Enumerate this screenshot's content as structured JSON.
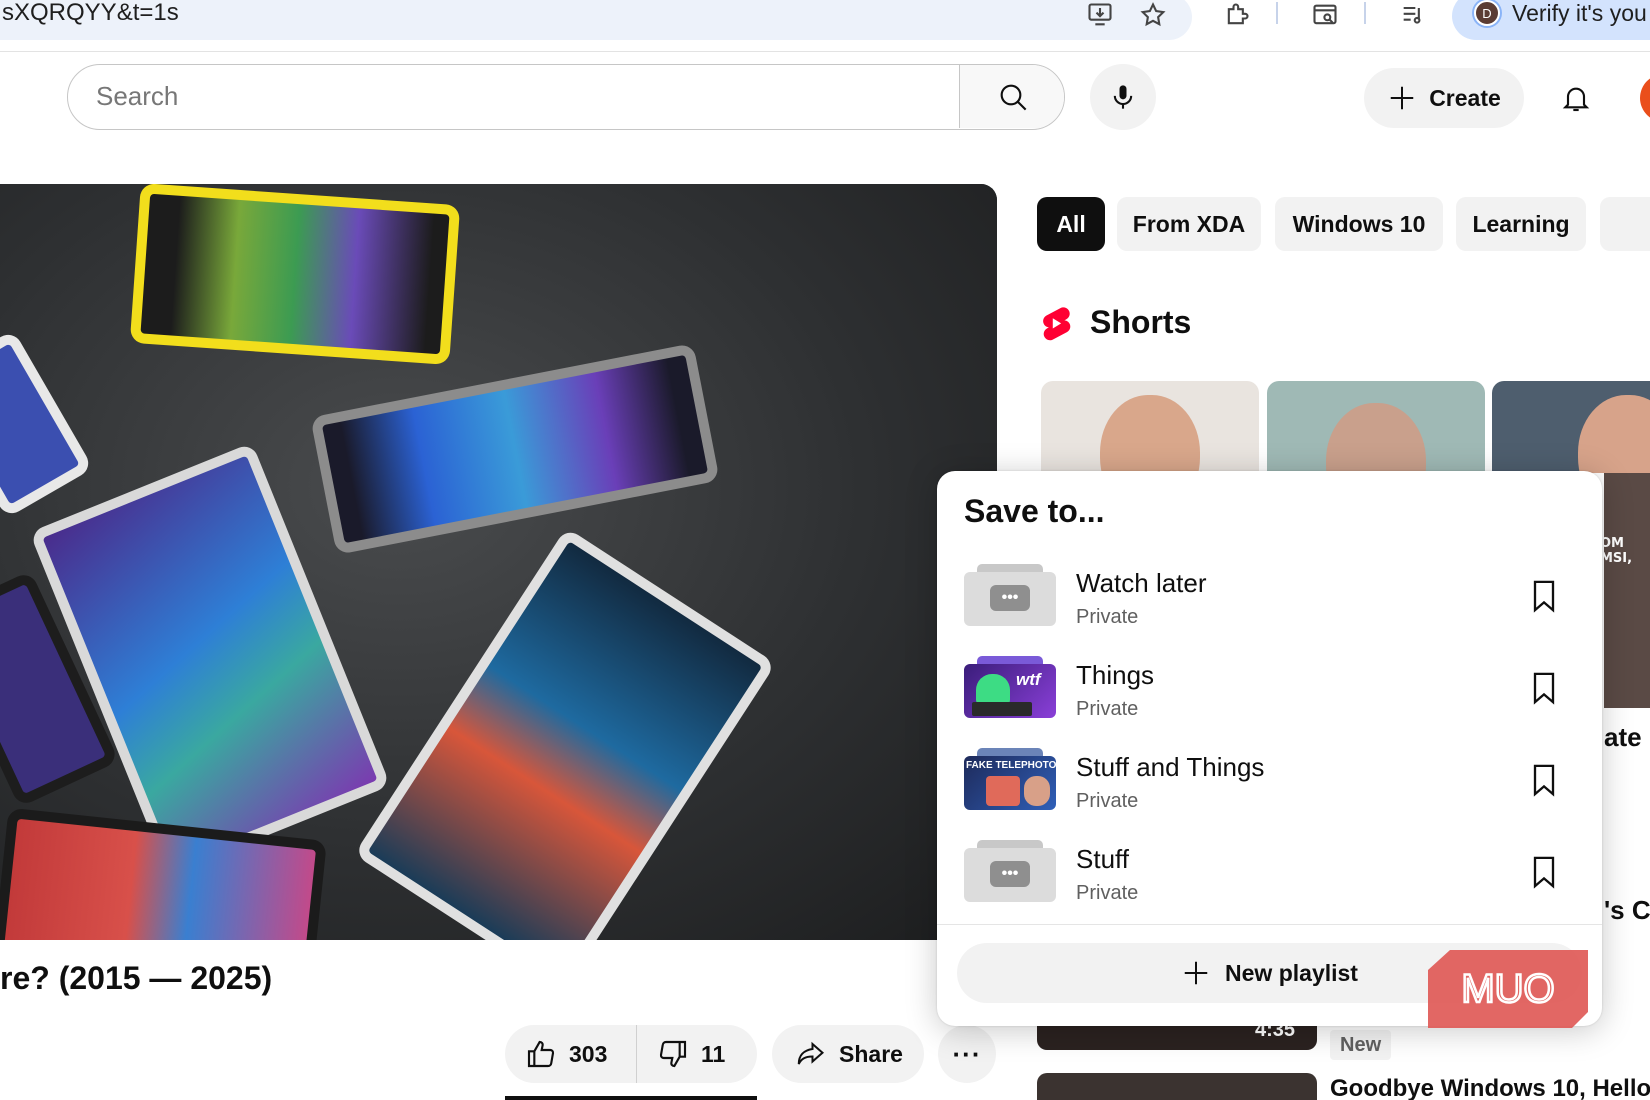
{
  "browser": {
    "url_fragment": "sXQRQYY&t=1s",
    "verify_avatar_letter": "D",
    "verify_label": "Verify it's you"
  },
  "header": {
    "search_placeholder": "Search",
    "create_label": "Create"
  },
  "video": {
    "title_fragment": "re? (2015 — 2025)",
    "likes": "303",
    "dislikes": "11",
    "share_label": "Share",
    "more_label": "···"
  },
  "chips": [
    {
      "label": "All",
      "active": true
    },
    {
      "label": "From XDA",
      "active": false
    },
    {
      "label": "Windows 10",
      "active": false
    },
    {
      "label": "Learning",
      "active": false
    }
  ],
  "shorts": {
    "title": "Shorts",
    "edge_caption": "OM MSI,"
  },
  "side_text": {
    "fragment_1": "ate",
    "fragment_2": "'s Ca",
    "duration": "4:35",
    "new_badge": "New",
    "related_title": "Goodbye Windows 10, Hello"
  },
  "save_dialog": {
    "title": "Save to...",
    "playlists": [
      {
        "name": "Watch later",
        "privacy": "Private",
        "thumb": "placeholder",
        "saved": false
      },
      {
        "name": "Things",
        "privacy": "Private",
        "thumb": "android-wtf",
        "saved": false
      },
      {
        "name": "Stuff and Things",
        "privacy": "Private",
        "thumb": "fake-telephoto",
        "saved": false
      },
      {
        "name": "Stuff",
        "privacy": "Private",
        "thumb": "placeholder",
        "saved": false
      }
    ],
    "new_playlist_label": "New playlist"
  },
  "watermark": {
    "text": "MUO",
    "color": "#e05a57"
  },
  "colors": {
    "youtube_red": "#ff0033",
    "chip_active_bg": "#0f0f0f",
    "chip_bg": "#f2f2f2",
    "url_bar_bg": "#edf2fa",
    "verify_bg": "#d3e3fd"
  }
}
